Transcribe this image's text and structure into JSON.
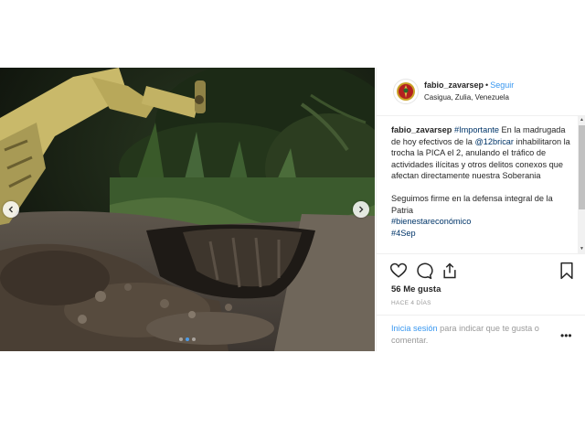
{
  "post": {
    "username": "fabio_zavarsep",
    "separator": "•",
    "follow_label": "Seguir",
    "location": "Casigua, Zulia, Venezuela",
    "caption": {
      "username": "fabio_zavarsep",
      "hashtag_importante": "#Importante",
      "text_1a": "En la madrugada de hoy efectivos de la",
      "mention": "@12bricar",
      "text_1b": "inhabilitaron la trocha la PICA el 2, anulando el tráfico de actividades ilícitas y otros delitos conexos que afectan directamente nuestra Soberania",
      "text_2": "Seguimos firme en la defensa integral de la Patria",
      "hashtag_bienestar": "#bienestareconómico",
      "hashtag_date": "#4Sep"
    },
    "likes": "56 Me gusta",
    "time_ago": "HACE 4 DÍAS",
    "login_link": "Inicia sesión",
    "login_text": "para indicar que te gusta o comentar.",
    "more": "•••",
    "carousel": {
      "slide_count": 3,
      "active_slide": 2
    }
  },
  "colors": {
    "link_blue": "#3897f0",
    "hashtag_blue": "#003569",
    "text": "#262626",
    "muted": "#999999",
    "divider": "#efefef",
    "active_dot": "#4d9ce8"
  },
  "icons": {
    "prev": "chevron-left-icon",
    "next": "chevron-right-icon",
    "like": "heart-icon",
    "comment": "comment-bubble-icon",
    "share": "share-icon",
    "save": "bookmark-icon",
    "more": "more-dots-icon",
    "avatar": "profile-emblem-icon"
  }
}
